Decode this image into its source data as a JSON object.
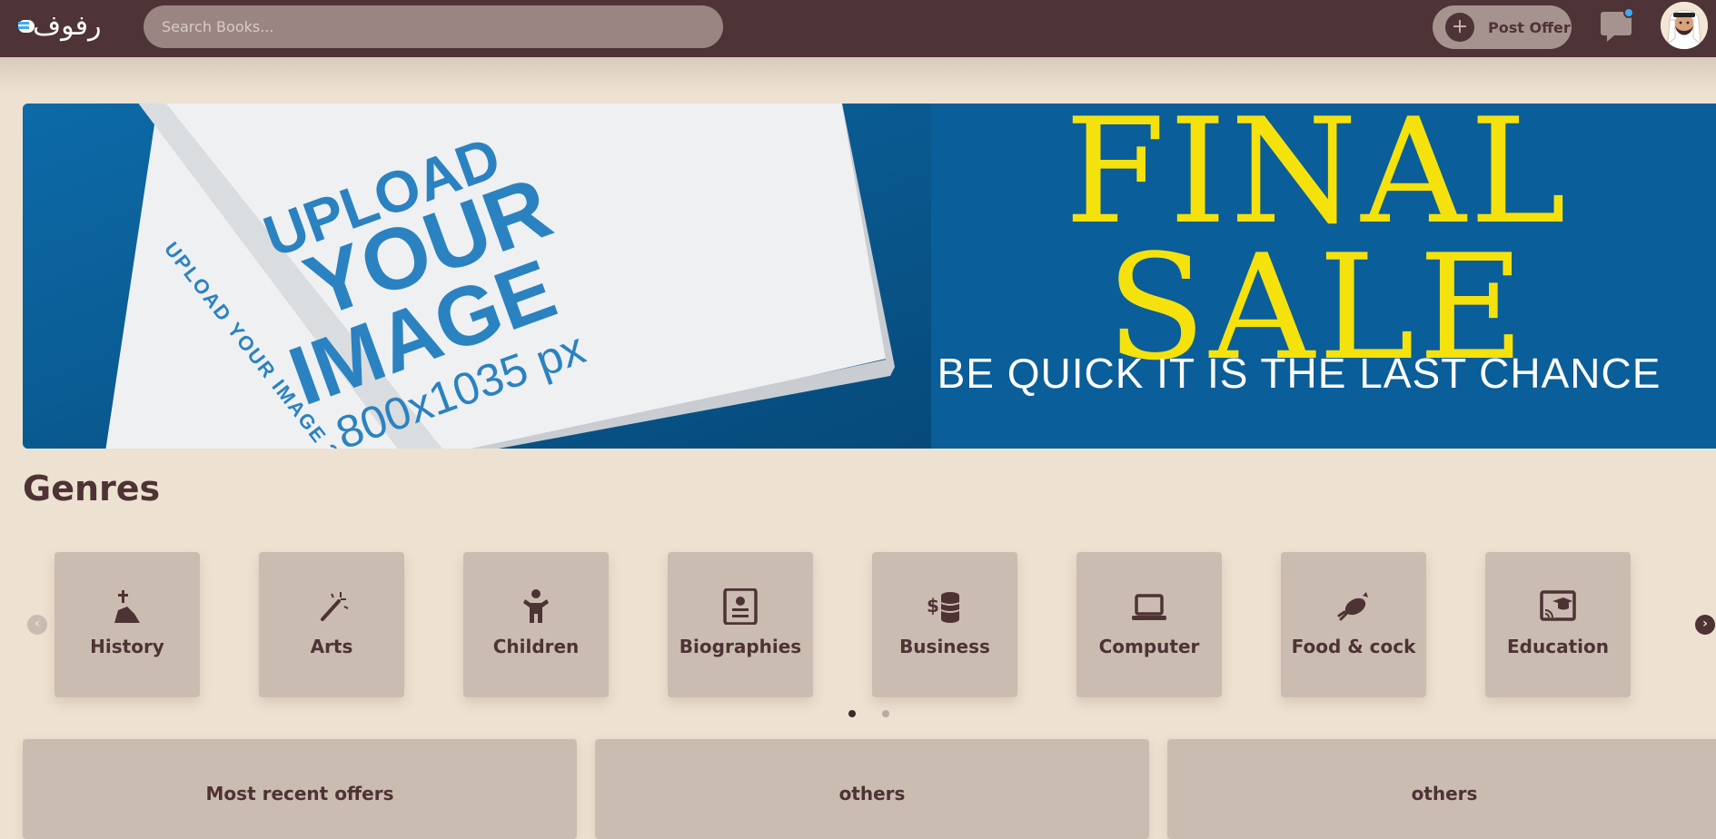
{
  "header": {
    "logo_text": "رفوف",
    "search_placeholder": "Search Books...",
    "post_offer_label": "Post Offer",
    "chat_has_notification": true,
    "notification_color": "#3fa9f5"
  },
  "banner": {
    "book_text_line1": "UPLOAD",
    "book_text_line2": "YOUR",
    "book_text_line3": "IMAGE",
    "book_text_line4": "800x1035 px",
    "book_spine_text": "UPLOAD YOUR IMAGE 200",
    "headline_line1": "FINAL",
    "headline_line2": "SALE",
    "tagline": "BE QUICK IT IS THE LAST CHANCE",
    "background_color": "#0a5e99",
    "headline_color": "#f5e20c"
  },
  "genres": {
    "title": "Genres",
    "items": [
      {
        "label": "History",
        "icon": "monument-icon"
      },
      {
        "label": "Arts",
        "icon": "magic-wand-icon"
      },
      {
        "label": "Children",
        "icon": "child-icon"
      },
      {
        "label": "Biographies",
        "icon": "id-card-icon"
      },
      {
        "label": "Business",
        "icon": "coins-icon"
      },
      {
        "label": "Computer",
        "icon": "laptop-icon"
      },
      {
        "label": "Food & cock",
        "icon": "food-icon"
      },
      {
        "label": "Education",
        "icon": "education-screen-icon"
      }
    ],
    "pagination": {
      "pages": 2,
      "active": 1
    }
  },
  "sections": [
    {
      "title": "Most recent offers"
    },
    {
      "title": "others"
    },
    {
      "title": "others"
    }
  ]
}
